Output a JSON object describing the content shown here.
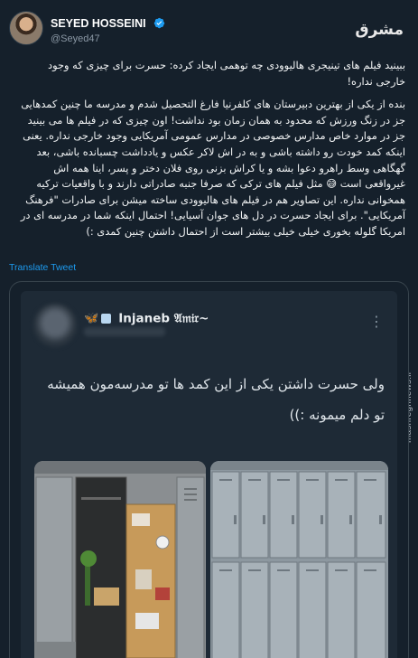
{
  "author": {
    "name": "SEYED HOSSEINI",
    "handle": "@Seyed47",
    "verified": true
  },
  "brand": {
    "logo_text": "مشرق",
    "watermark": "mashreghnews.ir"
  },
  "tweet": {
    "paragraphs": [
      "ببینید فیلم های تینیجری هالیوودی چه توهمی ایجاد کرده: حسرت برای چیزی که وجود خارجی نداره!",
      "بنده از یکی از بهترین دبیرستان های کلفرنیا فارغ التحصیل شدم و مدرسه ما چنین کمدهایی جز در زنگ ورزش که محدود به همان زمان بود نداشت! اون چیزی که در فیلم ها می بینید جز در موارد خاص مدارس خصوصی در مدارس عمومی آمریکایی وجود خارجی نداره. یعنی اینکه کمد خودت رو داشته باشی و به در اش لاکر عکس و یادداشت چسبانده باشی، بعد گهگاهی وسط راهرو دعوا بشه و یا کراش بزنی روی فلان دختر و پسر، اینا همه اش غیرواقعی است 😅 مثل فیلم های ترکی که صرفا جنبه صادراتی دارند و با واقعیات ترکیه همخوانی نداره. این تصاویر هم در فیلم های هالیوودی ساخته میشن برای صادرات \"فرهنگ آمریکایی\". برای ایجاد حسرت در دل های جوان آسیایی! احتمال اینکه شما در مدرسه ای در امریکا گلوله بخوری خیلی خیلی بیشتر است از احتمال داشتن چنین کمدی :)"
    ],
    "translate_label": "Translate Tweet"
  },
  "quoted": {
    "name": "Injaneb 𝔄𝔪𝔦𝔯~",
    "text": "ولی حسرت داشتن یکی از این کمد ها تو مدرسه‌مون همیشه تو دلم میمونه :))"
  },
  "colors": {
    "background": "#15202b",
    "link": "#1d9bf0",
    "verified": "#1d9bf0",
    "muted": "#8b98a5",
    "border": "#38444d"
  },
  "icons": [
    "verified-badge-icon",
    "butterfly-icon",
    "ice-cube-icon",
    "more-options-icon"
  ]
}
